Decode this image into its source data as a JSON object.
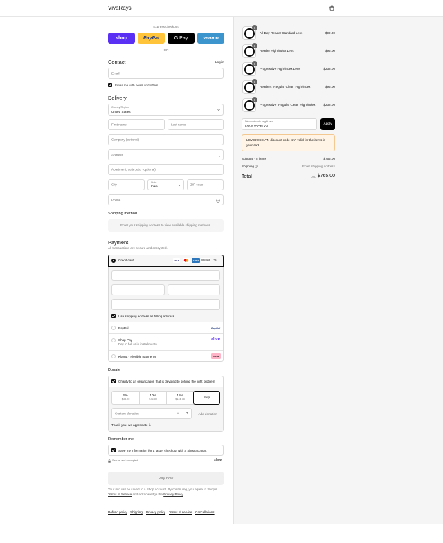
{
  "header": {
    "brand": "VivaRays"
  },
  "express": {
    "title": "Express checkout",
    "buttons": [
      {
        "label": "shop",
        "color": "#5a31f4"
      },
      {
        "label": "PayPal",
        "color": "#ffc439"
      },
      {
        "label": "G Pay",
        "color": "#000000"
      },
      {
        "label": "venmo",
        "color": "#3d95ce"
      }
    ],
    "or": "OR"
  },
  "contact": {
    "title": "Contact",
    "login": "Log in",
    "email_placeholder": "Email",
    "news_label": "Email me with news and offers"
  },
  "delivery": {
    "title": "Delivery",
    "country_label": "Country/Region",
    "country_value": "United States",
    "first_name": "First name",
    "last_name": "Last name",
    "company": "Company (optional)",
    "address": "Address",
    "apartment": "Apartment, suite, etc. (optional)",
    "city": "City",
    "state_label": "State",
    "state_value": "Iowa",
    "zip": "ZIP code",
    "phone": "Phone"
  },
  "shipping_method": {
    "title": "Shipping method",
    "note": "Enter your shipping address to view available shipping methods."
  },
  "payment": {
    "title": "Payment",
    "subtitle": "All transactions are secure and encrypted.",
    "credit_card": "Credit card",
    "card_badges": [
      "VISA",
      "MC",
      "AMEX",
      "DISCOVER"
    ],
    "more_cards": "+4",
    "billing_label": "Use shipping address as billing address",
    "paypal": "PayPal",
    "paypal_logo": "PayPal",
    "shop_pay": "Shop Pay",
    "shop_pay_sub": "Pay in full or in installments",
    "shop_logo": "shop",
    "klarna": "Klarna - Flexible payments",
    "klarna_logo": "Klarna."
  },
  "donate": {
    "title": "Donate",
    "charity_label": "Charity to an organization that is devoted to solving the light problem",
    "options": [
      {
        "pct": "5%",
        "amt": "$38.25"
      },
      {
        "pct": "10%",
        "amt": "$76.50"
      },
      {
        "pct": "15%",
        "amt": "$114.75"
      },
      {
        "pct": "Skip",
        "amt": ""
      }
    ],
    "custom_placeholder": "Custom donation",
    "minus": "−",
    "plus": "+",
    "add_label": "Add donation",
    "thanks": "Thank you, we appreciate it."
  },
  "remember": {
    "title": "Remember me",
    "save_label": "Save my information for a faster checkout with a Shop account",
    "secure": "Secure and encrypted",
    "shop_logo": "shop"
  },
  "pay_now": "Pay now",
  "legal": {
    "line1": "Your info will be saved to a Shop account. By continuing, you agree to Shop's",
    "tos": "Terms of Service",
    "mid": " and acknowledge the ",
    "privacy": "Privacy Policy",
    "end": "."
  },
  "footer": [
    "Refund policy",
    "Shipping",
    "Privacy policy",
    "Terms of service",
    "Cancellations"
  ],
  "order": {
    "items": [
      {
        "name": "All-Day Reader Standard Lens",
        "price": "$99.00",
        "qty": "1"
      },
      {
        "name": "Reader High-index Lens",
        "price": "$95.00",
        "qty": "1"
      },
      {
        "name": "Progressive High-index Lens",
        "price": "$238.00",
        "qty": "1"
      },
      {
        "name": "Readers \"Regular Clear\" High-index",
        "price": "$95.00",
        "qty": "1"
      },
      {
        "name": "Progressive \"Regular Clear\" High-index",
        "price": "$238.00",
        "qty": "1"
      }
    ],
    "discount_label": "Discount code or gift card",
    "discount_value": "LOVEJOCELYN",
    "apply": "Apply",
    "discount_error": "LOVEJOCELYN discount code isn't valid for the items in your cart",
    "subtotal_label": "Subtotal · 5 items",
    "subtotal_value": "$765.00",
    "shipping_label": "Shipping",
    "shipping_value": "Enter shipping address",
    "total_label": "Total",
    "currency": "USD",
    "total_value": "$765.00"
  }
}
